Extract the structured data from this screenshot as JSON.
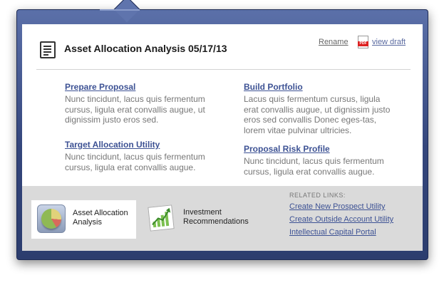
{
  "header": {
    "title": "Asset Allocation Analysis 05/17/13",
    "rename_label": "Rename",
    "pdf_badge": "PDF",
    "view_draft_label": "view draft"
  },
  "sections": [
    {
      "link": "Prepare Proposal",
      "desc": "Nunc tincidunt, lacus quis fermentum cursus, ligula erat convallis augue, ut dignissim justo eros sed."
    },
    {
      "link": "Build Portfolio",
      "desc": "Lacus quis fermentum cursus, ligula erat convallis augue, ut dignissim justo eros sed convallis Donec eges-tas, lorem vitae pulvinar ultricies."
    },
    {
      "link": "Target Allocation Utility",
      "desc": "Nunc tincidunt, lacus quis fermentum cursus, ligula erat convallis augue."
    },
    {
      "link": "Proposal Risk Profile",
      "desc": "Nunc tincidunt, lacus quis fermentum cursus, ligula erat convallis augue."
    }
  ],
  "footer": {
    "tiles": [
      {
        "label_line1": "Asset Allocation",
        "label_line2": "Analysis",
        "icon": "pie-chart-icon"
      },
      {
        "label_line1": "Investment",
        "label_line2": "Recommendations",
        "icon": "growth-chart-icon"
      }
    ],
    "related_header": "RELATED LINKS:",
    "related_links": [
      "Create New Prospect Utility",
      "Create Outside Account Utility",
      "Intellectual Capital Portal"
    ]
  },
  "colors": {
    "frame": "#34467c",
    "link": "#3d5294",
    "footer_bg": "#dadada"
  }
}
